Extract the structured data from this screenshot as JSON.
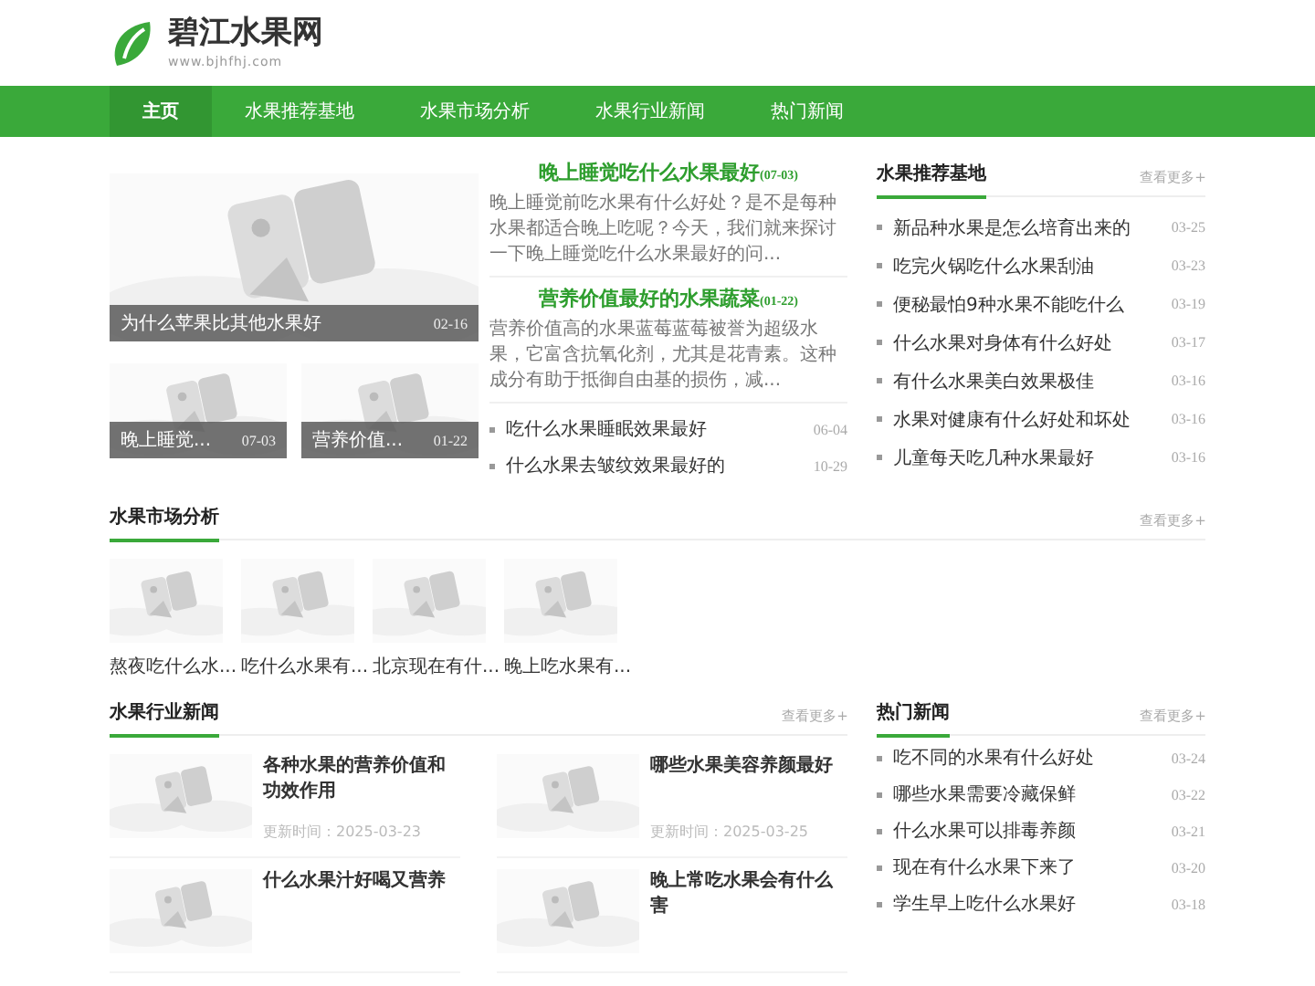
{
  "site": {
    "name": "碧江水果网",
    "domain": "www.bjhfhj.com"
  },
  "nav": [
    {
      "label": "主页",
      "selected": true
    },
    {
      "label": "水果推荐基地",
      "selected": false
    },
    {
      "label": "水果市场分析",
      "selected": false
    },
    {
      "label": "水果行业新闻",
      "selected": false
    },
    {
      "label": "热门新闻",
      "selected": false
    }
  ],
  "slides": [
    {
      "caption": "为什么苹果比其他水果好",
      "date": "02-16"
    },
    {
      "caption": "晚上睡觉...",
      "date": "07-03"
    },
    {
      "caption": "营养价值...",
      "date": "01-22"
    }
  ],
  "featured": [
    {
      "title": "晚上睡觉吃什么水果最好",
      "date": "(07-03)",
      "summary": "晚上睡觉前吃水果有什么好处？是不是每种水果都适合晚上吃呢？今天，我们就来探讨一下晚上睡觉吃什么水果最好的问..."
    },
    {
      "title": "营养价值最好的水果蔬菜",
      "date": "(01-22)",
      "summary": "营养价值高的水果蓝莓蓝莓被誉为超级水果，它富含抗氧化剂，尤其是花青素。这种成分有助于抵御自由基的损伤，减..."
    }
  ],
  "featured_list": [
    {
      "title": "吃什么水果睡眠效果最好",
      "date": "06-04"
    },
    {
      "title": "什么水果去皱纹效果最好的",
      "date": "10-29"
    }
  ],
  "recommend": {
    "title": "水果推荐基地",
    "more": "查看更多+",
    "items": [
      {
        "title": "新品种水果是怎么培育出来的",
        "date": "03-25"
      },
      {
        "title": "吃完火锅吃什么水果刮油",
        "date": "03-23"
      },
      {
        "title": "便秘最怕9种水果不能吃什么",
        "date": "03-19"
      },
      {
        "title": "什么水果对身体有什么好处",
        "date": "03-17"
      },
      {
        "title": "有什么水果美白效果极佳",
        "date": "03-16"
      },
      {
        "title": "水果对健康有什么好处和坏处",
        "date": "03-16"
      },
      {
        "title": "儿童每天吃几种水果最好",
        "date": "03-16"
      }
    ]
  },
  "market": {
    "title": "水果市场分析",
    "more": "查看更多+",
    "items": [
      {
        "title": "熬夜吃什么水..."
      },
      {
        "title": "吃什么水果有..."
      },
      {
        "title": "北京现在有什..."
      },
      {
        "title": "晚上吃水果有..."
      }
    ]
  },
  "industry": {
    "title": "水果行业新闻",
    "more": "查看更多+",
    "items": [
      {
        "title": "各种水果的营养价值和功效作用",
        "updated": "更新时间：2025-03-23"
      },
      {
        "title": "哪些水果美容养颜最好",
        "updated": "更新时间：2025-03-25"
      },
      {
        "title": "什么水果汁好喝又营养"
      },
      {
        "title": "晚上常吃水果会有什么害"
      }
    ]
  },
  "hot": {
    "title": "热门新闻",
    "more": "查看更多+",
    "items": [
      {
        "title": "吃不同的水果有什么好处",
        "date": "03-24"
      },
      {
        "title": "哪些水果需要冷藏保鲜",
        "date": "03-22"
      },
      {
        "title": "什么水果可以排毒养颜",
        "date": "03-21"
      },
      {
        "title": "现在有什么水果下来了",
        "date": "03-20"
      },
      {
        "title": "学生早上吃什么水果好",
        "date": "03-18"
      }
    ]
  }
}
